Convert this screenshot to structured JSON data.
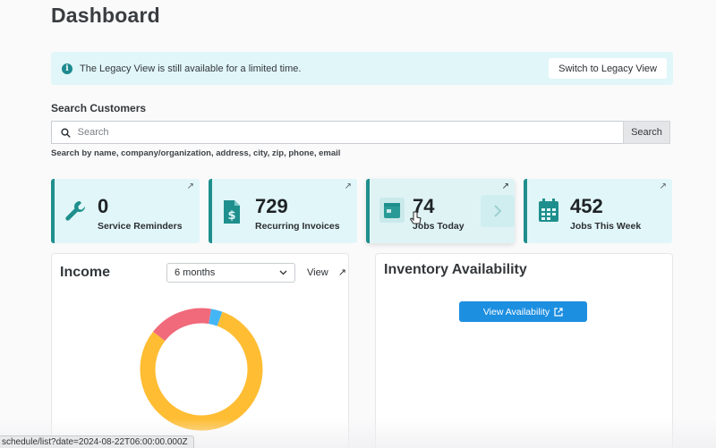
{
  "page": {
    "title": "Dashboard"
  },
  "banner": {
    "text": "The Legacy View is still available for a limited time.",
    "button_label": "Switch to Legacy View",
    "icon": "info-icon"
  },
  "search": {
    "label": "Search Customers",
    "placeholder": "Search",
    "button_label": "Search",
    "hint": "Search by name, company/organization, address, city, zip, phone, email"
  },
  "stats": [
    {
      "value": "0",
      "label": "Service Reminders",
      "icon": "wrench-icon"
    },
    {
      "value": "729",
      "label": "Recurring Invoices",
      "icon": "invoice-icon"
    },
    {
      "value": "74",
      "label": "Jobs Today",
      "icon": "calendar-day-icon"
    },
    {
      "value": "452",
      "label": "Jobs This Week",
      "icon": "calendar-week-icon"
    }
  ],
  "income": {
    "title": "Income",
    "period_selected": "6 months",
    "view_label": "View",
    "chart_data": {
      "type": "pie",
      "values": [
        80,
        17,
        3
      ],
      "colors": [
        "#ffbd33",
        "#f06a7b",
        "#45b6f5"
      ]
    }
  },
  "inventory": {
    "title": "Inventory Availability",
    "button_label": "View Availability"
  },
  "status_bar": {
    "url": "schedule/list?date=2024-08-22T06:00:00.000Z"
  },
  "colors": {
    "accent": "#1f8f8d",
    "card_bg": "#e1f6f8",
    "primary_button": "#1d8fe1"
  }
}
